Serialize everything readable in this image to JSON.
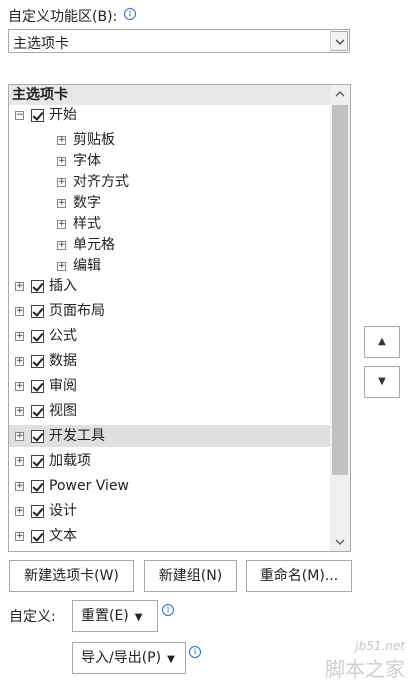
{
  "customize_ribbon": {
    "label": "自定义功能区(B):"
  },
  "combo": {
    "value": "主选项卡"
  },
  "tree": {
    "header": "主选项卡",
    "items": [
      {
        "label": "开始",
        "expander": "⊟",
        "checked": true,
        "level": 0
      },
      {
        "label": "剪贴板",
        "expander": "⊞",
        "level": 1
      },
      {
        "label": "字体",
        "expander": "⊞",
        "level": 1
      },
      {
        "label": "对齐方式",
        "expander": "⊞",
        "level": 1
      },
      {
        "label": "数字",
        "expander": "⊞",
        "level": 1
      },
      {
        "label": "样式",
        "expander": "⊞",
        "level": 1
      },
      {
        "label": "单元格",
        "expander": "⊞",
        "level": 1
      },
      {
        "label": "编辑",
        "expander": "⊞",
        "level": 1
      },
      {
        "label": "插入",
        "expander": "⊞",
        "checked": true,
        "level": 0
      },
      {
        "label": "页面布局",
        "expander": "⊞",
        "checked": true,
        "level": 0
      },
      {
        "label": "公式",
        "expander": "⊞",
        "checked": true,
        "level": 0
      },
      {
        "label": "数据",
        "expander": "⊞",
        "checked": true,
        "level": 0
      },
      {
        "label": "审阅",
        "expander": "⊞",
        "checked": true,
        "level": 0
      },
      {
        "label": "视图",
        "expander": "⊞",
        "checked": true,
        "level": 0
      },
      {
        "label": "开发工具",
        "expander": "⊞",
        "checked": true,
        "level": 0,
        "selected": true
      },
      {
        "label": "加载项",
        "expander": "⊞",
        "checked": true,
        "level": 0
      },
      {
        "label": "Power View",
        "expander": "⊞",
        "checked": true,
        "level": 0
      },
      {
        "label": "设计",
        "expander": "⊞",
        "checked": true,
        "level": 0
      },
      {
        "label": "文本",
        "expander": "⊞",
        "checked": true,
        "level": 0
      }
    ]
  },
  "buttons": {
    "new_tab": "新建选项卡(W)",
    "new_group": "新建组(N)",
    "rename": "重命名(M)...",
    "move_up": "▲",
    "move_down": "▼"
  },
  "customizations": {
    "label": "自定义:",
    "reset": "重置(E)",
    "import_export": "导入/导出(P)"
  },
  "watermark": {
    "site": "jb51.net",
    "brand": "脚本之家"
  }
}
